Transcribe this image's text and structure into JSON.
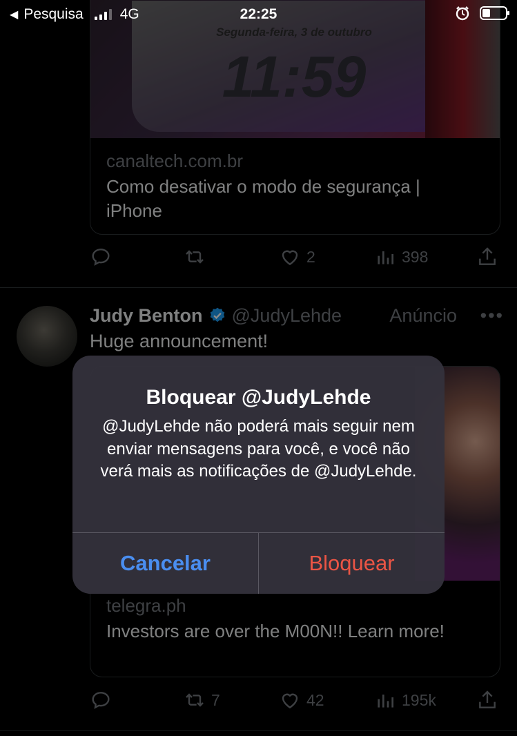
{
  "status_bar": {
    "back_label": "Pesquisa",
    "network": "4G",
    "time": "22:25"
  },
  "tweet1": {
    "image": {
      "date_text": "Segunda-feira, 3 de outubro",
      "clock_text": "11:59"
    },
    "link_domain": "canaltech.com.br",
    "link_title": "Como desativar o modo de segurança | iPhone",
    "likes": "2",
    "views": "398"
  },
  "tweet2": {
    "author_name": "Judy Benton",
    "author_handle": "@JudyLehde",
    "ad_label": "Anúncio",
    "more_label": "•••",
    "text": "Huge announcement!",
    "link_domain": "telegra.ph",
    "link_title": "Investors are over the M00N!! Learn more!",
    "retweets": "7",
    "likes": "42",
    "views": "195k"
  },
  "alert": {
    "title": "Bloquear @JudyLehde",
    "message": "@JudyLehde não poderá mais seguir nem enviar mensagens para você, e você não verá mais as notificações de @JudyLehde.",
    "cancel_label": "Cancelar",
    "confirm_label": "Bloquear"
  },
  "colors": {
    "background": "#000000",
    "accent_blue": "#4a8ef0",
    "destructive_red": "#eb5545",
    "verified_blue": "#1d9bf0",
    "muted_text": "#71767b"
  },
  "icons": {
    "reply": "reply-icon",
    "retweet": "retweet-icon",
    "like": "heart-icon",
    "views": "views-icon",
    "share": "share-icon"
  }
}
